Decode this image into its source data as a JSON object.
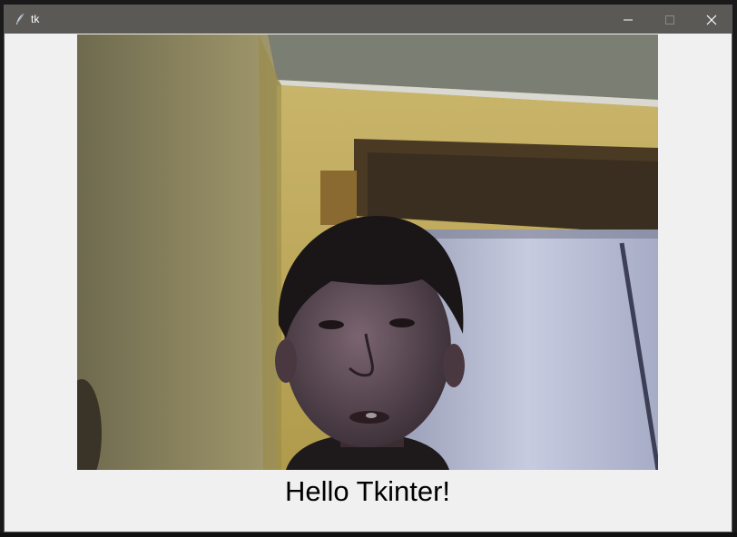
{
  "window": {
    "title": "tk",
    "app_icon": "feather-icon",
    "controls": {
      "minimize_icon": "minimize-icon",
      "maximize_icon": "maximize-icon",
      "close_icon": "close-icon"
    },
    "colors": {
      "titlebar": "#5b5955",
      "client_background": "#f0f0f0"
    }
  },
  "content": {
    "image_description": "webcam-frame",
    "label_text": "Hello Tkinter!"
  }
}
